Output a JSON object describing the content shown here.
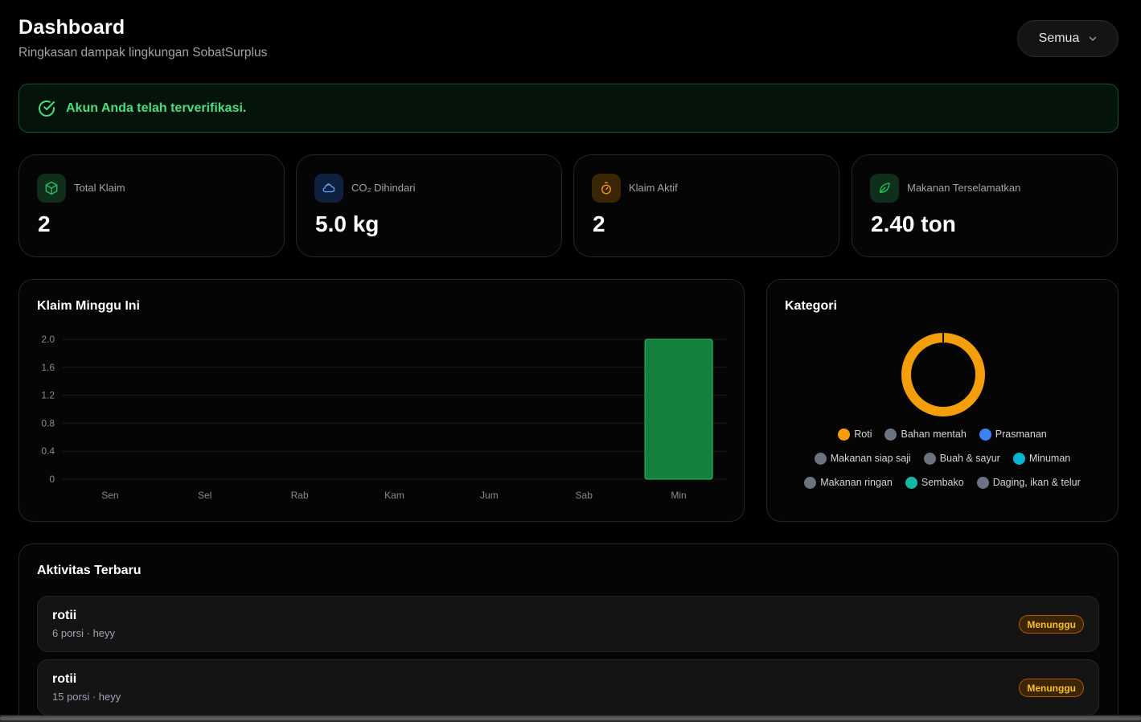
{
  "header": {
    "title": "Dashboard",
    "subtitle": "Ringkasan dampak lingkungan SobatSurplus"
  },
  "filter": {
    "label": "Semua"
  },
  "verified": {
    "text": "Akun Anda telah terverifikasi."
  },
  "stats": [
    {
      "label": "Total Klaim",
      "value": "2",
      "icon": "box-icon",
      "color": "#22c55e"
    },
    {
      "label": "CO₂ Dihindari",
      "value": "5.0 kg",
      "icon": "cloud-icon",
      "color": "#60a5fa"
    },
    {
      "label": "Klaim Aktif",
      "value": "2",
      "icon": "timer-icon",
      "color": "#f59e0b"
    },
    {
      "label": "Makanan Terselamatkan",
      "value": "2.40 ton",
      "icon": "leaf-icon",
      "color": "#22c55e"
    }
  ],
  "weekly": {
    "title": "Klaim Minggu Ini",
    "chart_data": {
      "type": "bar",
      "categories": [
        "Sen",
        "Sel",
        "Rab",
        "Kam",
        "Jum",
        "Sab",
        "Min"
      ],
      "values": [
        0,
        0,
        0,
        0,
        0,
        0,
        2
      ],
      "ylim": [
        0,
        2
      ],
      "yticks": [
        "0",
        "0.4",
        "0.8",
        "1.2",
        "1.6",
        "2.0"
      ],
      "bar_color": "#15803d",
      "grid": true
    }
  },
  "kategori": {
    "title": "Kategori",
    "chart_data": {
      "type": "pie",
      "labels": [
        "Roti",
        "Bahan mentah",
        "Prasmanan",
        "Makanan siap saji",
        "Buah & sayur",
        "Minuman",
        "Makanan ringan",
        "Sembako",
        "Daging, ikan & telur"
      ],
      "values": [
        2,
        0,
        0,
        0,
        0,
        0,
        0,
        0,
        0
      ],
      "colors": [
        "#f59e0b",
        "#6b7280",
        "#3b82f6",
        "#6b7280",
        "#6b7280",
        "#06b6d4",
        "#6b7280",
        "#14b8a6",
        "#6b7280"
      ]
    }
  },
  "activity": {
    "title": "Aktivitas Terbaru",
    "items": [
      {
        "name": "rotii",
        "meta": "6 porsi · heyy",
        "status": "Menunggu"
      },
      {
        "name": "rotii",
        "meta": "15 porsi · heyy",
        "status": "Menunggu"
      }
    ]
  }
}
